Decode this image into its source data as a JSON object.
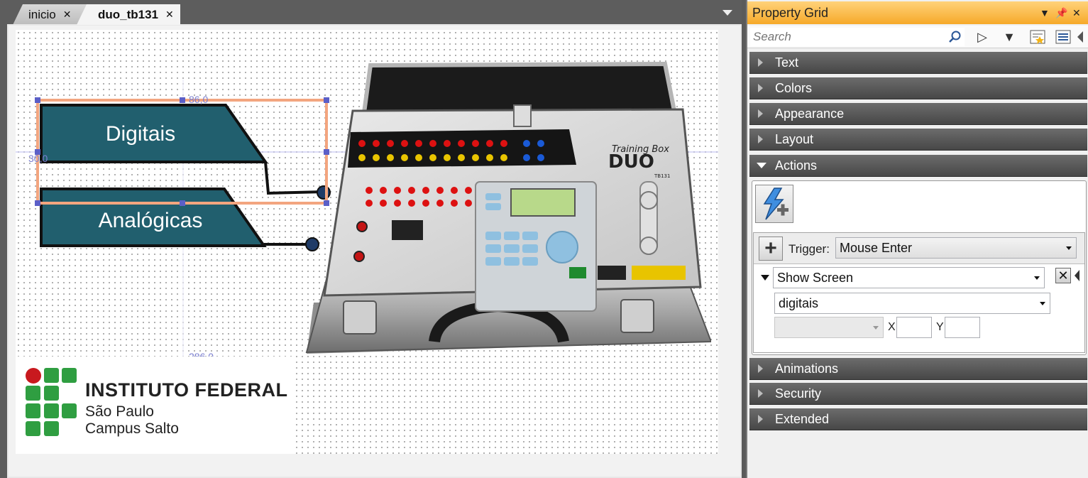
{
  "tabs": [
    {
      "label": "inicio",
      "close": "✕"
    },
    {
      "label": "duo_tb131",
      "close": "✕"
    }
  ],
  "canvas": {
    "dimension_labels": {
      "width_top": "86,0",
      "left_value": "30,0",
      "bottom_value": "286,0"
    },
    "buttons": {
      "digitais": "Digitais",
      "analogicas": "Analógicas"
    },
    "logo": {
      "line1": "INSTITUTO FEDERAL",
      "line2": "São Paulo",
      "line3": "Campus Salto"
    },
    "device": {
      "brand_line1": "Training Box",
      "brand_line2": "DUO",
      "model": "TB131"
    }
  },
  "property_grid": {
    "title": "Property Grid",
    "search_placeholder": "Search",
    "categories": {
      "text": "Text",
      "colors": "Colors",
      "appearance": "Appearance",
      "layout": "Layout",
      "actions": "Actions",
      "animations": "Animations",
      "security": "Security",
      "extended": "Extended"
    },
    "actions": {
      "trigger_label": "Trigger:",
      "trigger_value": "Mouse Enter",
      "action_value": "Show Screen",
      "target_value": "digitais",
      "param_value": "",
      "x_label": "X",
      "y_label": "Y",
      "x_value": "",
      "y_value": ""
    }
  },
  "colors": {
    "accent_title": "#f6a929",
    "button_fill": "#215f6e",
    "selection": "#f3a57f",
    "logo_green": "#2f9e41",
    "logo_red": "#c8191e"
  }
}
